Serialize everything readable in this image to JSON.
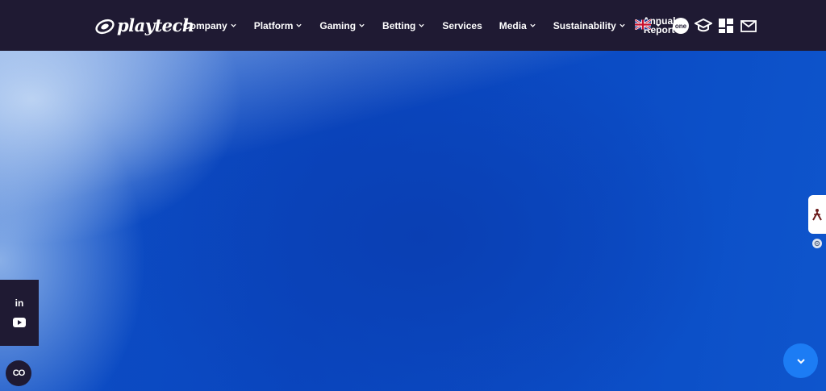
{
  "brand": {
    "logo_text": "playtech"
  },
  "nav": {
    "items": [
      {
        "label": "Company",
        "dropdown": true
      },
      {
        "label": "Platform",
        "dropdown": true
      },
      {
        "label": "Gaming",
        "dropdown": true
      },
      {
        "label": "Betting",
        "dropdown": true
      },
      {
        "label": "Services",
        "dropdown": false
      },
      {
        "label": "Media",
        "dropdown": true
      },
      {
        "label": "Sustainability",
        "dropdown": true
      }
    ],
    "annual_report": {
      "line1": "Annual",
      "line2": "Report"
    }
  },
  "language": {
    "flag": "uk-flag-icon"
  },
  "header_icons": [
    {
      "name": "one-icon",
      "text": "one"
    },
    {
      "name": "graduation-cap-icon"
    },
    {
      "name": "app-grid-icon"
    },
    {
      "name": "mail-icon"
    }
  ],
  "social": [
    {
      "name": "linkedin-icon",
      "text": "in"
    },
    {
      "name": "youtube-icon"
    }
  ],
  "bottom_left": {
    "text": "CO"
  },
  "colors": {
    "header_bg": "#1f1a33",
    "hero_blue": "#0a4cc4",
    "scroll_button": "#1c7cf4",
    "access_icon": "#6b1b1b"
  }
}
